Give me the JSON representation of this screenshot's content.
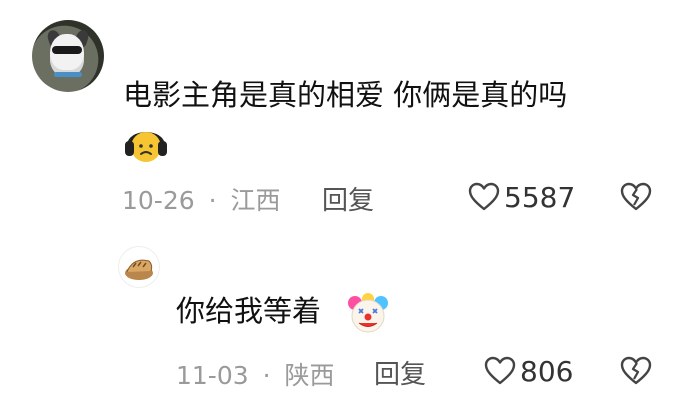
{
  "comment": {
    "text": "电影主角是真的相爱  你俩是真的吗",
    "date": "10-26",
    "separator": "·",
    "location": "江西",
    "reply_label": "回复",
    "likes": "5587"
  },
  "reply": {
    "text": "你给我等着",
    "date": "11-03",
    "separator": "·",
    "location": "陕西",
    "reply_label": "回复",
    "likes": "806"
  },
  "icons": {
    "like": "heart-outline-icon",
    "dislike": "broken-heart-icon",
    "emoji1": "headphones-worried-emoji",
    "emoji2": "clown-face-emoji"
  }
}
